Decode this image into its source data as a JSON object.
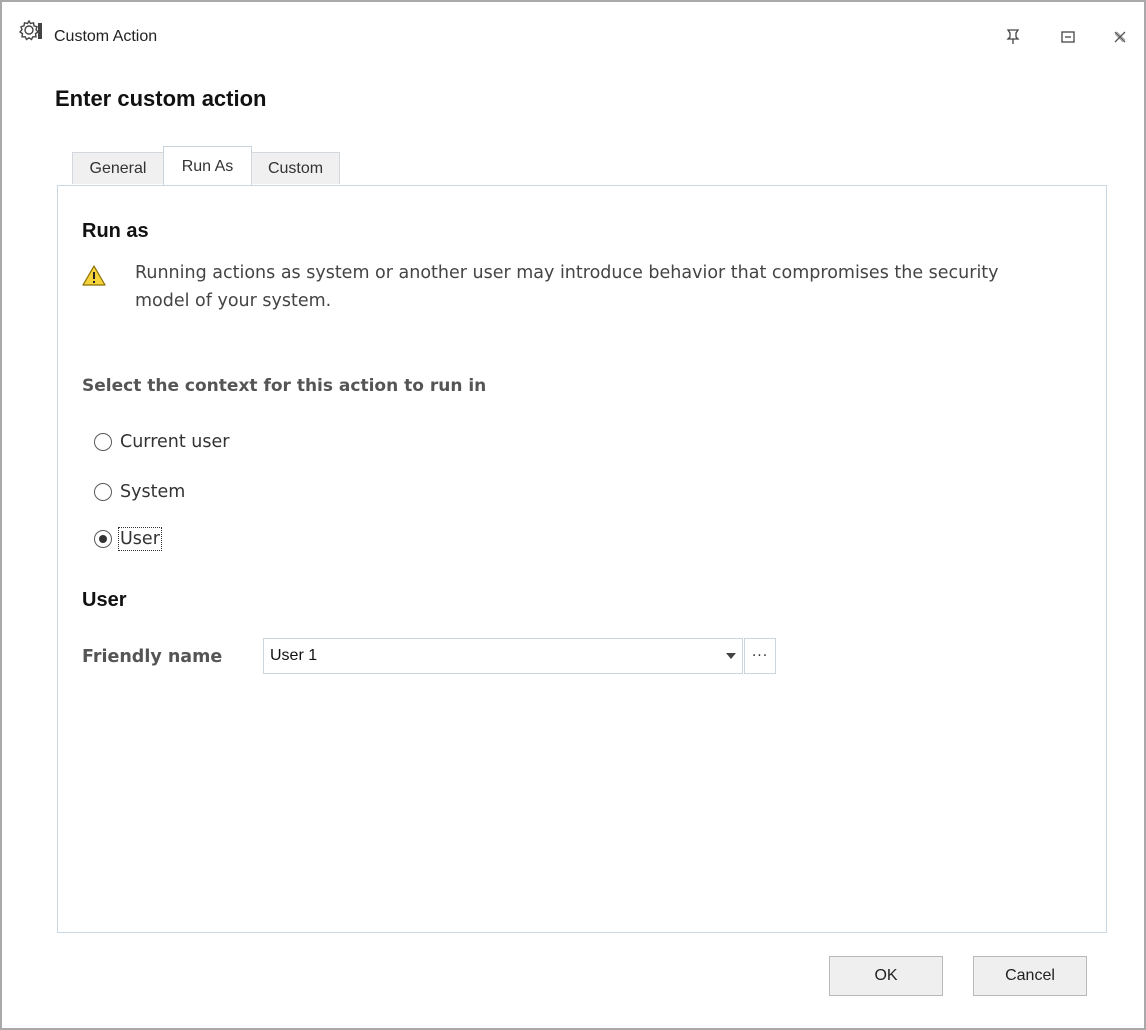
{
  "window": {
    "title": "Custom Action",
    "title_icon": "gear-icon",
    "controls": [
      {
        "name": "pin-icon"
      },
      {
        "name": "maximize-icon"
      },
      {
        "name": "close-icon"
      }
    ]
  },
  "dialog": {
    "heading": "Enter custom action"
  },
  "tabs": [
    {
      "label": "General",
      "active": false
    },
    {
      "label": "Run As",
      "active": true
    },
    {
      "label": "Custom",
      "active": false
    }
  ],
  "run_as": {
    "title": "Run as",
    "warning_icon": "warning-icon",
    "warning_text": "Running actions as system or another user may introduce behavior that compromises the security model of your system.",
    "context_label": "Select the context for this action to run in",
    "options": [
      {
        "label": "Current user",
        "selected": false
      },
      {
        "label": "System",
        "selected": false
      },
      {
        "label": "User",
        "selected": true
      }
    ]
  },
  "user": {
    "title": "User",
    "friendly_name_label": "Friendly name",
    "friendly_name_value": "User 1",
    "ellipsis_label": "···"
  },
  "buttons": {
    "ok": "OK",
    "cancel": "Cancel"
  },
  "colors": {
    "warning_fill": "#f5d33b",
    "warning_stroke": "#8a6d00",
    "panel_border": "#c9d9e3"
  }
}
